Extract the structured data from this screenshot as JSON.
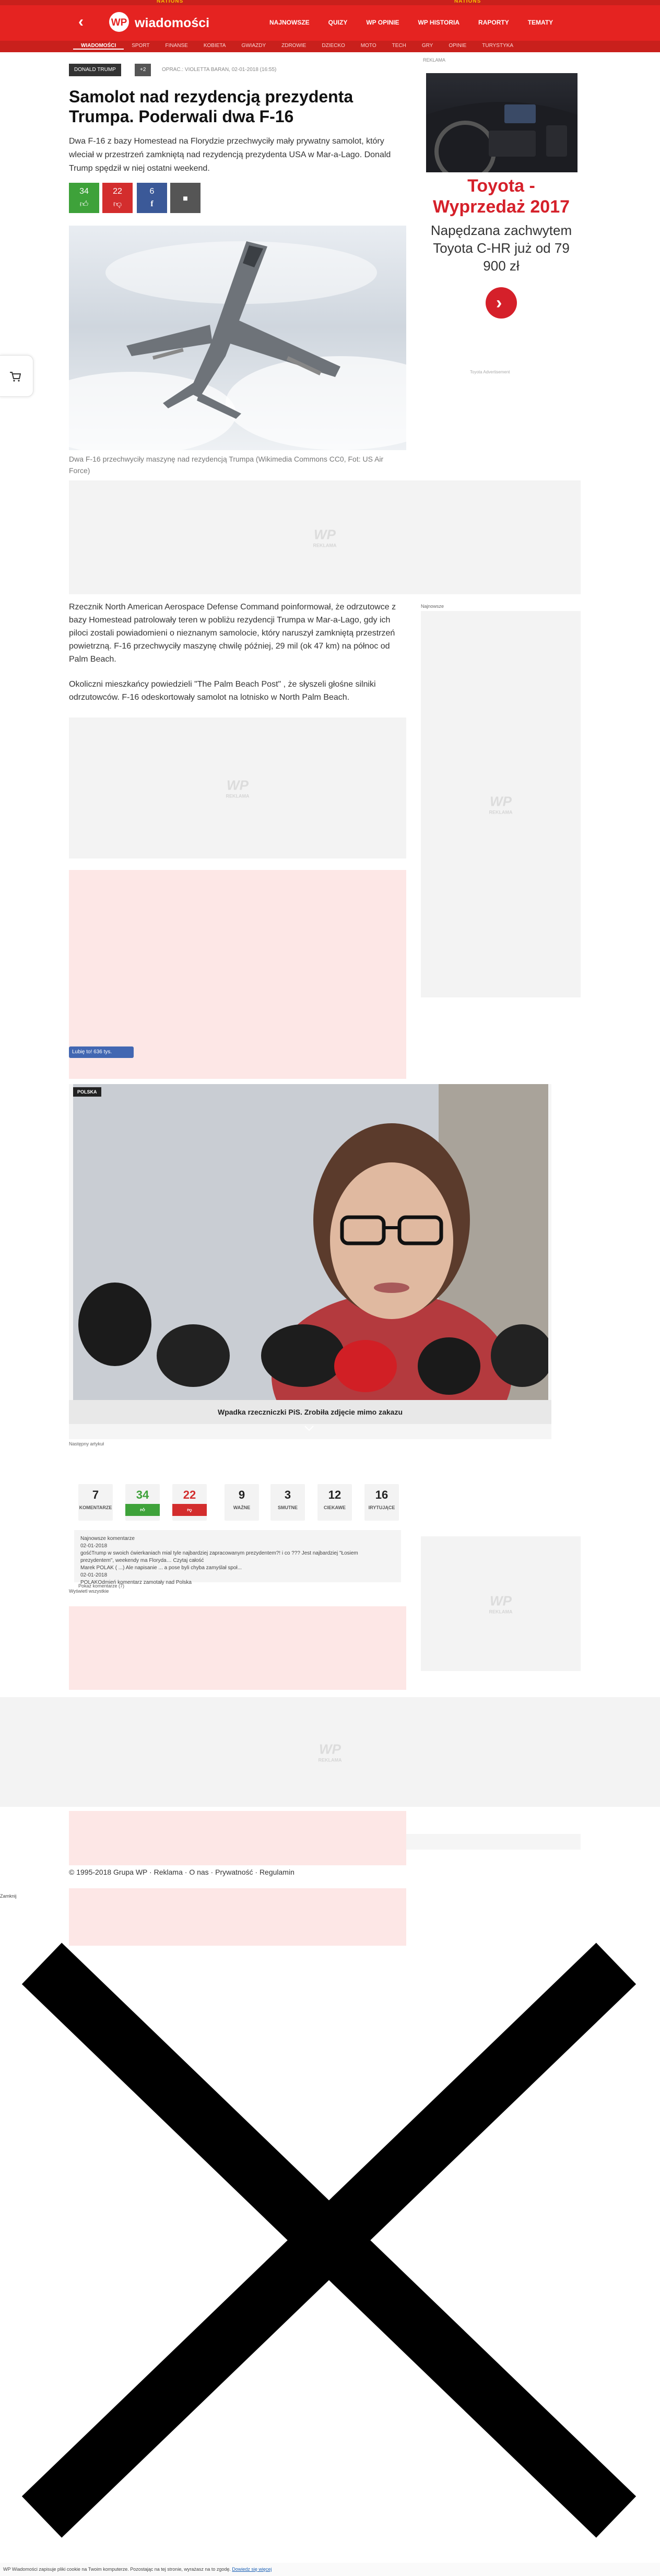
{
  "top_banner": {
    "text_left": "NATIONS",
    "text_right": "NATIONS"
  },
  "header": {
    "logo_text": "wiadomości",
    "nav": [
      "NAJNOWSZE",
      "QUIZY",
      "WP OPINIE",
      "WP HISTORIA",
      "RAPORTY",
      "TEMATY"
    ]
  },
  "subnav": [
    "WIADOMOŚCI",
    "SPORT",
    "FINANSE",
    "KOBIETA",
    "GWIAZDY",
    "ZDROWIE",
    "DZIECKO",
    "MOTO",
    "TECH",
    "GRY",
    "OPINIE",
    "TURYSTYKA"
  ],
  "article": {
    "tag": "DONALD TRUMP",
    "tag_extra": "+2",
    "meta": "OPRAC.: VIOLETTA BARAN, 02-01-2018 (16:55)",
    "title": "Samolot nad rezydencją prezydenta Trumpa. Poderwali dwa F-16",
    "lead": "Dwa F-16 z bazy Homestead na Florydzie przechwyciły mały prywatny samolot, który wleciał w przestrzeń zamkniętą nad rezydencją prezydenta USA w Mar-a-Lago. Donald Trump spędził w niej ostatni weekend.",
    "votes": {
      "up": "34",
      "down": "22",
      "share": "6"
    },
    "image_caption": "Dwa F-16 przechwyciły maszynę nad rezydencją Trumpa (Wikimedia Commons CC0, Fot: US Air Force)",
    "paragraph1": "Rzecznik North American Aerospace Defense Command poinformował, że odrzutowce z bazy Homestead patrolowały teren w pobliżu rezydencji Trumpa w Mar-a-Lago, gdy ich piloci zostali powiadomieni o nieznanym samolocie, który naruszył zamkniętą przestrzeń powietrzną. F-16 przechwyciły maszynę chwilę później, 29 mil (ok 47 km) na północ od Palm Beach.",
    "paragraph2": "Okoliczni mieszkańcy powiedzieli \"The Palm Beach Post\" , że słyszeli głośne silniki odrzutowców. F-16 odeskortowały samolot na lotnisko w North Palm Beach."
  },
  "ads": {
    "label": "REKLAMA",
    "brand_title": "Toyota - Wyprzedaż 2017",
    "brand_text": "Napędzana zachwytem Toyota C-HR już od 79 900 zł",
    "footer": "Toyota Advertisement",
    "placeholder": "REKLAMA",
    "placeholder_logo": "WP"
  },
  "sidebar": {
    "najnowsze": "Najnowsze"
  },
  "facebook": {
    "like_label": "Lubię to! 636 tys."
  },
  "promo": {
    "label": "POLSKA",
    "caption": "Wpadka rzeczniczki PiS. Zrobiła zdjęcie mimo zakazu",
    "sub": "Następny artykuł"
  },
  "comments": {
    "counts": [
      {
        "value": "7",
        "label": "KOMENTARZE"
      },
      {
        "value": "34",
        "label": ""
      },
      {
        "value": "22",
        "label": ""
      },
      {
        "value": "9",
        "label": "WAŻNE"
      },
      {
        "value": "3",
        "label": "SMUTNE"
      },
      {
        "value": "12",
        "label": "CIEKAWE"
      },
      {
        "value": "16",
        "label": "IRYTUJĄCE"
      }
    ],
    "box_title": "Najnowsze komentarze",
    "box_lines": [
      "02-01-2018",
      "gośćTrump w swoich ćwierkaniach mial tyle najbardziej zapracowanym prezydentem?! i co ??? Jest najbardziej \"Łosiem",
      "prezydentem\", weekendy ma Floryda… Czytaj całość",
      "Marek POLAK ( ...) Ale napisanie ... a pose byli chyba zamyślał społ...",
      "02-01-2018",
      "POLAKOdmień komentarz zamotały nad Polska",
      "Pokaż komentarze (7)"
    ],
    "box_footer": "Wyświetl wszystkie"
  },
  "footer": {
    "copyright": "© 1995-2018 Grupa WP",
    "links": [
      "Reklama",
      "O nas",
      "Prywatność",
      "Regulamin"
    ],
    "close": "Zamknij"
  },
  "bottom_bar": {
    "text": "WP Wiadomości zapisuje pliki cookie na Twoim komputerze. Pozostając na tej stronie, wyrażasz na to zgodę.",
    "link": "Dowiedz się więcej"
  },
  "colors": {
    "brand_red": "#e52321",
    "vote_green": "#3ea23a",
    "vote_red": "#d32d2d",
    "fb_blue": "#3b5998",
    "toyota_red": "#d5202a"
  }
}
